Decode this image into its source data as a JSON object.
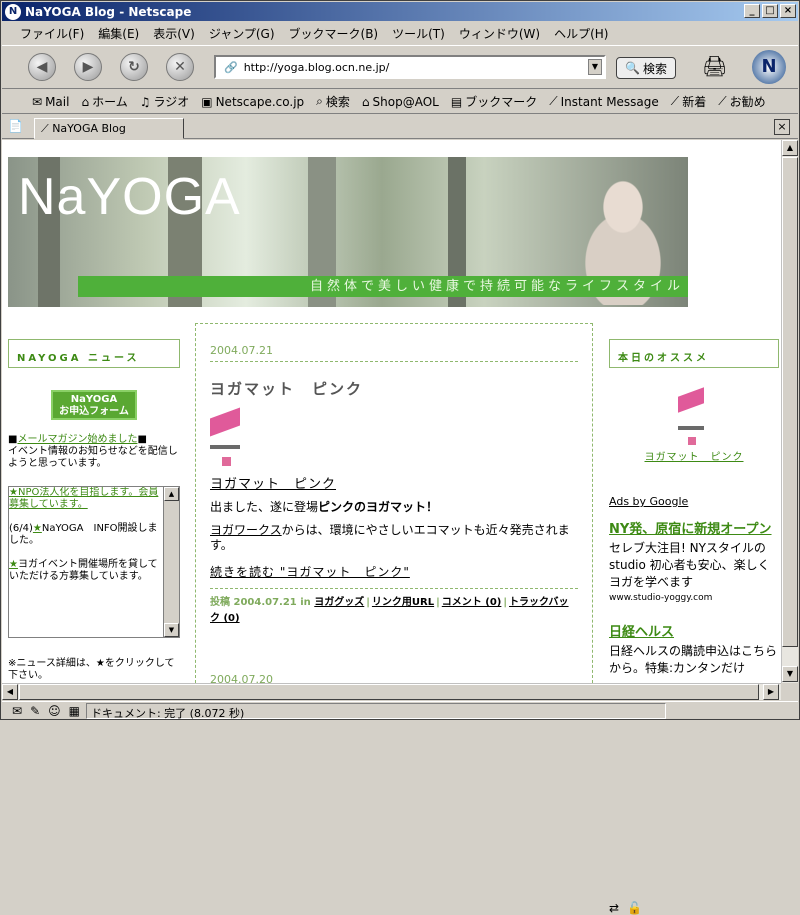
{
  "window": {
    "title": "NaYOGA Blog - Netscape",
    "controls": [
      "_",
      "□",
      "×"
    ]
  },
  "menu": [
    "ファイル(F)",
    "編集(E)",
    "表示(V)",
    "ジャンプ(G)",
    "ブックマーク(B)",
    "ツール(T)",
    "ウィンドウ(W)",
    "ヘルプ(H)"
  ],
  "nav": {
    "url": "http://yoga.blog.ocn.ne.jp/",
    "search_label": "検索"
  },
  "personal_toolbar": [
    {
      "icon": "mail-icon",
      "label": "Mail"
    },
    {
      "icon": "home-icon",
      "label": "ホーム"
    },
    {
      "icon": "headphones-icon",
      "label": "ラジオ"
    },
    {
      "icon": "my-icon",
      "label": "Netscape.co.jp"
    },
    {
      "icon": "search-icon",
      "label": "検索"
    },
    {
      "icon": "shop-icon",
      "label": "Shop@AOL"
    },
    {
      "icon": "bookmark-icon",
      "label": "ブックマーク"
    },
    {
      "icon": "bookmark-icon",
      "label": "Instant Message"
    },
    {
      "icon": "bookmark-icon",
      "label": "新着"
    },
    {
      "icon": "bookmark-icon",
      "label": "お勧め"
    }
  ],
  "tab": {
    "label": "NaYOGA Blog"
  },
  "banner": {
    "logo": "NaYOGA",
    "tagline": "自然体で美しい健康で持続可能なライフスタイル"
  },
  "left": {
    "news_heading": "NAYOGA ニュース",
    "form_button_line1": "NaYOGA",
    "form_button_line2": "お申込フォーム",
    "mail_link": "メールマガジン始めました",
    "mail_text": "イベント情報のお知らせなどを配信しようと思っています。",
    "news_item1": "★NPO法人化を目指します。会員募集しています。",
    "news_item2a": "(6/4)",
    "news_item2b": "★",
    "news_item2c": "NaYOGA　INFO開設しました。",
    "news_item3a": "★",
    "news_item3b": "ヨガイベント開催場所を貸していただける方募集しています。",
    "footnote": "※ニュース詳細は、★をクリックして下さい。"
  },
  "post": {
    "date": "2004.07.21",
    "title": "ヨガマット　ピンク",
    "item_link": "ヨガマット　ピンク",
    "para1a": "出ました、遂に登場",
    "para1b": "ピンクのヨガマット！",
    "para2a": "ヨガワークス",
    "para2b": "からは、環境にやさしいエコマットも近々発売されます。",
    "more": "続きを読む \"ヨガマット　ピンク\"",
    "meta_posted": "投稿 2004.07.21 in",
    "meta_category": "ヨガグッズ",
    "meta_permalink": "リンク用URL",
    "meta_comments": "コメント (0)",
    "meta_trackback": "トラックバック (0)",
    "next_date": "2004.07.20"
  },
  "right": {
    "heading": "本日のオススメ",
    "rec_link": "ヨガマット　ピンク",
    "ads_label": "Ads by Google",
    "ad1_title": "NY発、原宿に新規オープン",
    "ad1_text": "セレブ大注目! NYスタイルのstudio 初心者も安心、楽しくヨガを学べます",
    "ad1_url": "www.studio-yoggy.com",
    "ad2_title": "日経ヘルス",
    "ad2_text": "日経ヘルスの購読申込はこちらから。特集:カンタンだけ"
  },
  "status": {
    "message": "ドキュメント: 完了 (8.072 秒)"
  }
}
